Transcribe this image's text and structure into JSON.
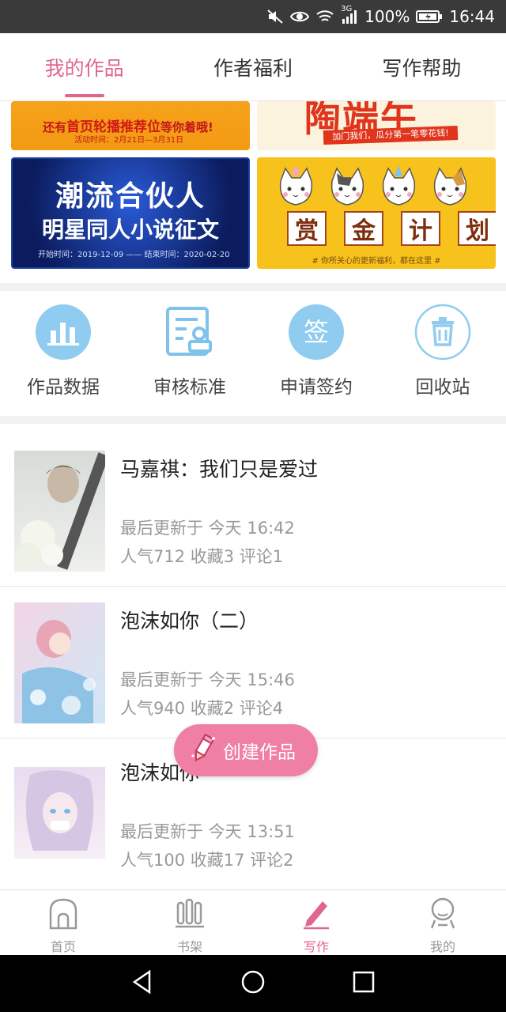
{
  "status_bar": {
    "signal_label": "3G",
    "battery": "100%",
    "time": "16:44"
  },
  "tabs": [
    {
      "label": "我的作品",
      "active": true
    },
    {
      "label": "作者福利",
      "active": false
    },
    {
      "label": "写作帮助",
      "active": false
    }
  ],
  "banners": {
    "banner1": {
      "line_prefix": "还有",
      "line_highlight": "首页轮播推荐位",
      "line_suffix": "等你着哦!",
      "date": "活动时间：2月21日—3月31日"
    },
    "banner2": {
      "title": "陶端午",
      "subtitle": "加门我们，瓜分第一笔零花钱!"
    },
    "banner3": {
      "line1": "潮流合伙人",
      "line2": "明星同人小说征文",
      "date": "开始时间：2019-12-09 —— 结束时间：2020-02-20"
    },
    "banner4": {
      "chars": [
        "赏",
        "金",
        "计",
        "划"
      ],
      "footer": "# 你所关心的更新福利，都在这里 #"
    }
  },
  "actions": [
    {
      "label": "作品数据",
      "icon": "bar-chart-icon"
    },
    {
      "label": "审核标准",
      "icon": "review-standard-icon"
    },
    {
      "label": "申请签约",
      "icon": "sign-contract-icon"
    },
    {
      "label": "回收站",
      "icon": "trash-icon"
    }
  ],
  "works": [
    {
      "title": "马嘉祺：我们只是爱过",
      "updated": "最后更新于 今天 16:42",
      "stats": "人气712  收藏3  评论1"
    },
    {
      "title": "泡沫如你（二）",
      "updated": "最后更新于 今天 15:46",
      "stats": "人气940  收藏2  评论4"
    },
    {
      "title": "泡沫如你",
      "updated": "最后更新于 今天 13:51",
      "stats": "人气100  收藏17  评论2"
    }
  ],
  "fab": {
    "label": "创建作品"
  },
  "bottom_nav": [
    {
      "label": "首页",
      "icon": "home-icon",
      "active": false
    },
    {
      "label": "书架",
      "icon": "bookshelf-icon",
      "active": false
    },
    {
      "label": "写作",
      "icon": "pen-icon",
      "active": true
    },
    {
      "label": "我的",
      "icon": "profile-icon",
      "active": false
    }
  ],
  "colors": {
    "accent": "#e0668f",
    "fab": "#f07fa6",
    "icon_blue": "#7ec3ec"
  }
}
